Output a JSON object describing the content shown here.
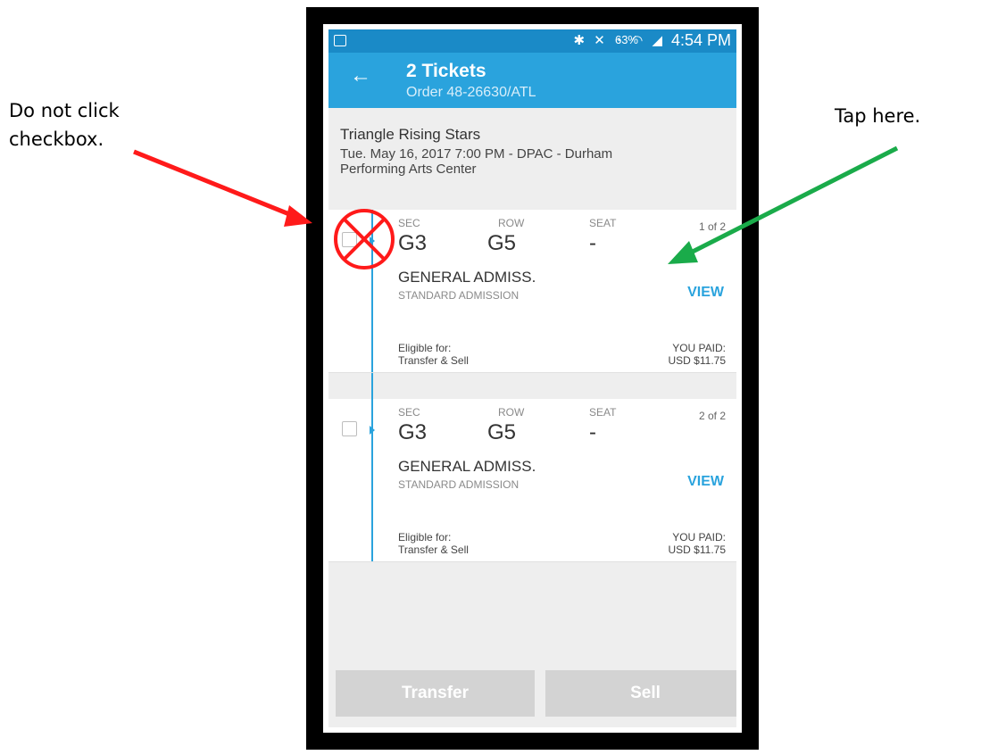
{
  "annotations": {
    "left_line1": "Do not click",
    "left_line2": "checkbox.",
    "right": "Tap here.",
    "colors": {
      "warning": "#ff1a1a",
      "hint": "#1aab4a"
    }
  },
  "status_bar": {
    "battery_percent": "63%",
    "time": "4:54 PM",
    "icons": [
      "bluetooth-icon",
      "mute-icon",
      "alarm-icon",
      "wifi-icon",
      "signal-icon",
      "battery-icon",
      "gallery-icon"
    ]
  },
  "app_bar": {
    "title": "2 Tickets",
    "subtitle": "Order 48-26630/ATL"
  },
  "event": {
    "title": "Triangle Rising Stars",
    "details": "Tue. May 16, 2017 7:00 PM - DPAC - Durham Performing Arts Center"
  },
  "tickets": [
    {
      "sec_label": "SEC",
      "row_label": "ROW",
      "seat_label": "SEAT",
      "sec": "G3",
      "row": "G5",
      "seat": "-",
      "count": "1 of 2",
      "admission": "GENERAL ADMISS.",
      "admission_sub": "STANDARD ADMISSION",
      "view": "VIEW",
      "eligible_label": "Eligible for:",
      "eligible_value": "Transfer & Sell",
      "paid_label": "YOU PAID:",
      "paid_value": "USD $11.75"
    },
    {
      "sec_label": "SEC",
      "row_label": "ROW",
      "seat_label": "SEAT",
      "sec": "G3",
      "row": "G5",
      "seat": "-",
      "count": "2 of 2",
      "admission": "GENERAL ADMISS.",
      "admission_sub": "STANDARD ADMISSION",
      "view": "VIEW",
      "eligible_label": "Eligible for:",
      "eligible_value": "Transfer & Sell",
      "paid_label": "YOU PAID:",
      "paid_value": "USD $11.75"
    }
  ],
  "actions": {
    "transfer": "Transfer",
    "sell": "Sell"
  },
  "colors": {
    "app_bar": "#2aa3dd",
    "status_bar": "#1a8ac7",
    "accent": "#2aa3dd",
    "disabled_button": "#d3d3d3"
  }
}
